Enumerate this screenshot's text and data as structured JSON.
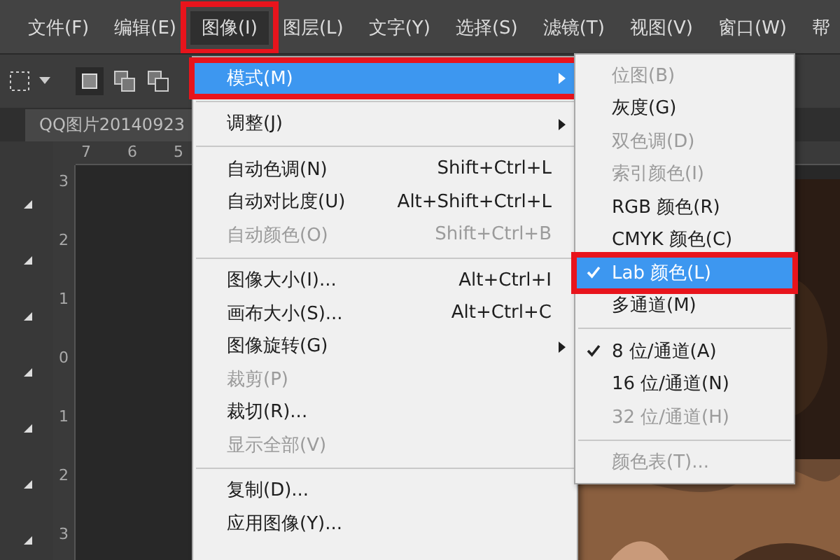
{
  "menubar": [
    {
      "label": "文件(F)",
      "selected": false,
      "marked": false
    },
    {
      "label": "编辑(E)",
      "selected": false,
      "marked": false
    },
    {
      "label": "图像(I)",
      "selected": true,
      "marked": true
    },
    {
      "label": "图层(L)",
      "selected": false,
      "marked": false
    },
    {
      "label": "文字(Y)",
      "selected": false,
      "marked": false
    },
    {
      "label": "选择(S)",
      "selected": false,
      "marked": false
    },
    {
      "label": "滤镜(T)",
      "selected": false,
      "marked": false
    },
    {
      "label": "视图(V)",
      "selected": false,
      "marked": false
    },
    {
      "label": "窗口(W)",
      "selected": false,
      "marked": false
    },
    {
      "label": "帮",
      "selected": false,
      "marked": false
    }
  ],
  "document_tab": {
    "title": "QQ图片20140923"
  },
  "ruler": {
    "horizontal": [
      "7",
      "6",
      "5"
    ],
    "vertical": [
      "3",
      "2",
      "1",
      "0",
      "1",
      "2",
      "3"
    ]
  },
  "image_menu": [
    {
      "kind": "item",
      "label": "模式(M)",
      "submenu": true,
      "disabled": false,
      "selected": true,
      "marked": true
    },
    {
      "kind": "separator"
    },
    {
      "kind": "item",
      "label": "调整(J)",
      "submenu": true,
      "disabled": false,
      "selected": false,
      "marked": false
    },
    {
      "kind": "separator"
    },
    {
      "kind": "item",
      "label": "自动色调(N)",
      "shortcut": "Shift+Ctrl+L",
      "disabled": false,
      "selected": false,
      "marked": false
    },
    {
      "kind": "item",
      "label": "自动对比度(U)",
      "shortcut": "Alt+Shift+Ctrl+L",
      "disabled": false,
      "selected": false,
      "marked": false
    },
    {
      "kind": "item",
      "label": "自动颜色(O)",
      "shortcut": "Shift+Ctrl+B",
      "disabled": true,
      "selected": false,
      "marked": false
    },
    {
      "kind": "separator"
    },
    {
      "kind": "item",
      "label": "图像大小(I)...",
      "shortcut": "Alt+Ctrl+I",
      "disabled": false,
      "selected": false,
      "marked": false
    },
    {
      "kind": "item",
      "label": "画布大小(S)...",
      "shortcut": "Alt+Ctrl+C",
      "disabled": false,
      "selected": false,
      "marked": false
    },
    {
      "kind": "item",
      "label": "图像旋转(G)",
      "submenu": true,
      "disabled": false,
      "selected": false,
      "marked": false
    },
    {
      "kind": "item",
      "label": "裁剪(P)",
      "disabled": true,
      "selected": false,
      "marked": false
    },
    {
      "kind": "item",
      "label": "裁切(R)...",
      "disabled": false,
      "selected": false,
      "marked": false
    },
    {
      "kind": "item",
      "label": "显示全部(V)",
      "disabled": true,
      "selected": false,
      "marked": false
    },
    {
      "kind": "separator"
    },
    {
      "kind": "item",
      "label": "复制(D)...",
      "disabled": false,
      "selected": false,
      "marked": false
    },
    {
      "kind": "item",
      "label": "应用图像(Y)...",
      "disabled": false,
      "selected": false,
      "marked": false
    }
  ],
  "mode_submenu": [
    {
      "kind": "item",
      "label": "位图(B)",
      "checked": false,
      "disabled": true,
      "selected": false,
      "marked": false
    },
    {
      "kind": "item",
      "label": "灰度(G)",
      "checked": false,
      "disabled": false,
      "selected": false,
      "marked": false
    },
    {
      "kind": "item",
      "label": "双色调(D)",
      "checked": false,
      "disabled": true,
      "selected": false,
      "marked": false
    },
    {
      "kind": "item",
      "label": "索引颜色(I)",
      "checked": false,
      "disabled": true,
      "selected": false,
      "marked": false
    },
    {
      "kind": "item",
      "label": "RGB 颜色(R)",
      "checked": false,
      "disabled": false,
      "selected": false,
      "marked": false
    },
    {
      "kind": "item",
      "label": "CMYK 颜色(C)",
      "checked": false,
      "disabled": false,
      "selected": false,
      "marked": false
    },
    {
      "kind": "item",
      "label": "Lab 颜色(L)",
      "checked": true,
      "disabled": false,
      "selected": true,
      "marked": true
    },
    {
      "kind": "item",
      "label": "多通道(M)",
      "checked": false,
      "disabled": false,
      "selected": false,
      "marked": false
    },
    {
      "kind": "separator"
    },
    {
      "kind": "item",
      "label": "8 位/通道(A)",
      "checked": true,
      "disabled": false,
      "selected": false,
      "marked": false
    },
    {
      "kind": "item",
      "label": "16 位/通道(N)",
      "checked": false,
      "disabled": false,
      "selected": false,
      "marked": false
    },
    {
      "kind": "item",
      "label": "32 位/通道(H)",
      "checked": false,
      "disabled": true,
      "selected": false,
      "marked": false
    },
    {
      "kind": "separator"
    },
    {
      "kind": "item",
      "label": "颜色表(T)...",
      "checked": false,
      "disabled": true,
      "selected": false,
      "marked": false
    }
  ]
}
